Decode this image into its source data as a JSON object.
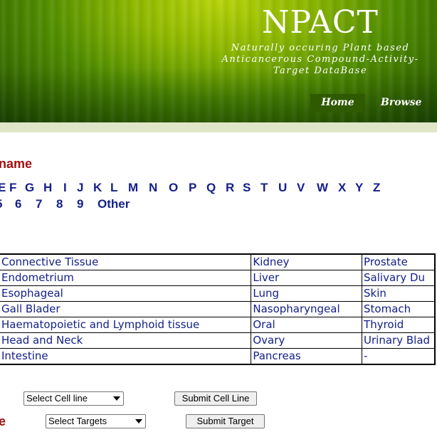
{
  "header": {
    "title": "NPACT",
    "tagline_line1": "Naturally occuring Plant based",
    "tagline_line2": "Anticancerous Compound-Activity-",
    "tagline_line3": "Target DataBase",
    "nav": {
      "home": "Home",
      "browse": "Browse"
    }
  },
  "section": {
    "heading_fragment": "name"
  },
  "alphabet": {
    "row1": [
      "E",
      "F",
      "G",
      "H",
      "I",
      "J",
      "K",
      "L",
      "M",
      "N",
      "O",
      "P",
      "Q",
      "R",
      "S",
      "T",
      "U",
      "V",
      "W",
      "X",
      "Y",
      "Z"
    ],
    "row2": [
      "5",
      "6",
      "7",
      "8",
      "9",
      "Other"
    ]
  },
  "tissue_table": {
    "rows": [
      [
        "Connective Tissue",
        "Kidney",
        "Prostate"
      ],
      [
        "Endometrium",
        "Liver",
        "Salivary Du"
      ],
      [
        "Esophageal",
        "Lung",
        "Skin"
      ],
      [
        "Gall Blader",
        "Nasopharyngeal",
        "Stomach"
      ],
      [
        "Haematopoietic and Lymphoid tissue",
        "Oral",
        "Thyroid"
      ],
      [
        "Head and Neck",
        "Ovary",
        "Urinary Blad"
      ],
      [
        "Intestine",
        "Pancreas",
        "-"
      ]
    ]
  },
  "cell_line": {
    "select_value": "Select Cell line",
    "submit_label": "Submit Cell Line"
  },
  "target": {
    "label_fragment": "e",
    "select_value": "Select Targets",
    "submit_label": "Submit Target"
  },
  "colors": {
    "link": "#14208a",
    "heading": "#a01010",
    "nav_active": "#2f5a00",
    "header_green": "#4f8c00"
  }
}
